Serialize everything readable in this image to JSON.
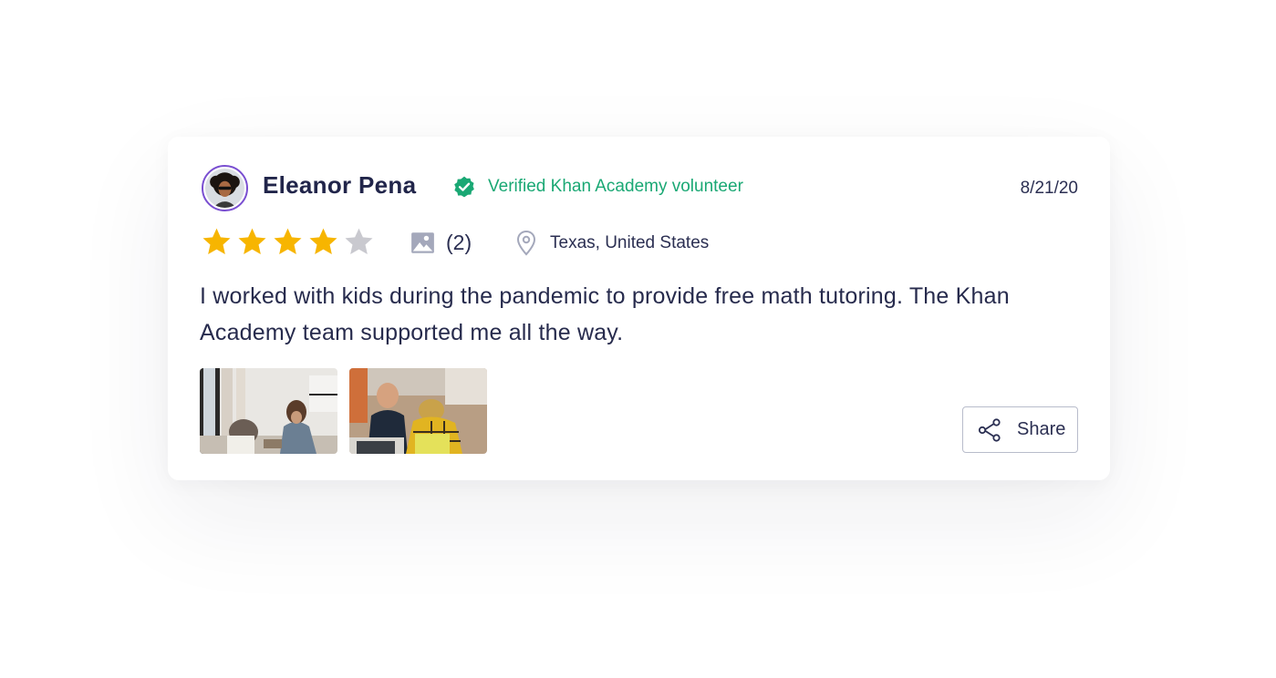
{
  "review": {
    "author_name": "Eleanor Pena",
    "verified_label": "Verified Khan Academy volunteer",
    "date": "8/21/20",
    "rating": 4,
    "rating_max": 5,
    "photo_count_label": "(2)",
    "location": "Texas, United States",
    "text": "I worked with kids during the pandemic to provide free math tutoring. The Khan Academy team supported me all the way.",
    "share_label": "Share"
  },
  "icons": {
    "verified": "verified-badge-icon",
    "star": "star-icon",
    "photo": "image-icon",
    "location": "map-pin-icon",
    "share": "share-icon"
  },
  "colors": {
    "accent_green": "#1aa874",
    "star_filled": "#f7b500",
    "star_empty": "#c9c9cf",
    "avatar_ring": "#7a4fd1",
    "text_dark": "#21254a"
  }
}
